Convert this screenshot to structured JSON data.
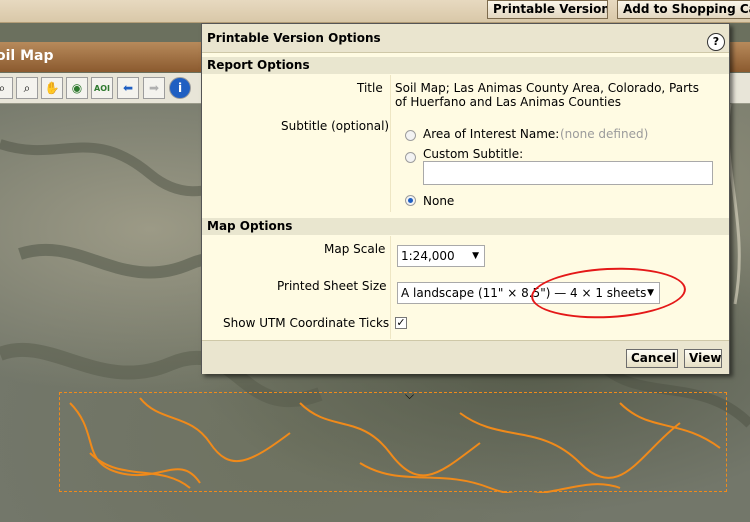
{
  "topbar": {
    "printable_version": "Printable Version",
    "add_to_cart": "Add to Shopping Ca"
  },
  "soil_map": {
    "title": "oil Map"
  },
  "toolbar": {
    "tools": [
      {
        "icon": "zoom-in-icon",
        "glyph": "⌕"
      },
      {
        "icon": "zoom-out-icon",
        "glyph": "⌕"
      },
      {
        "icon": "pan-hand-icon",
        "glyph": "✋"
      },
      {
        "icon": "globe-icon",
        "glyph": "◉"
      },
      {
        "icon": "aoi-icon",
        "glyph": "AOI"
      },
      {
        "icon": "back-arrow-icon",
        "glyph": "⬅"
      },
      {
        "icon": "forward-arrow-icon",
        "glyph": "➡"
      },
      {
        "icon": "info-icon",
        "glyph": "i"
      }
    ]
  },
  "dialog": {
    "title": "Printable Version Options",
    "help_glyph": "?",
    "report_options": {
      "heading": "Report Options",
      "title_label": "Title",
      "title_value": "Soil Map; Las Animas County Area, Colorado, Parts of Huerfano and Las Animas Counties",
      "subtitle_label": "Subtitle (optional)",
      "aoi_name_label": "Area of Interest Name:",
      "aoi_name_value": "(none defined)",
      "custom_subtitle_label": "Custom Subtitle:",
      "custom_subtitle_value": "",
      "none_label": "None",
      "selected": "none"
    },
    "map_options": {
      "heading": "Map Options",
      "scale_label": "Map Scale",
      "scale_value": "1:24,000",
      "sheet_label": "Printed Sheet Size",
      "sheet_value": "A landscape (11\" × 8.5\") — 4 × 1 sheets",
      "utm_label": "Show UTM Coordinate Ticks",
      "utm_checked": "✓"
    },
    "buttons": {
      "cancel": "Cancel",
      "view": "View"
    }
  },
  "map": {
    "collapse_glyph": "⌵"
  },
  "colors": {
    "aoi_outline": "#f08a1a",
    "annotation": "#e41818",
    "accent": "#1f5fc2"
  }
}
